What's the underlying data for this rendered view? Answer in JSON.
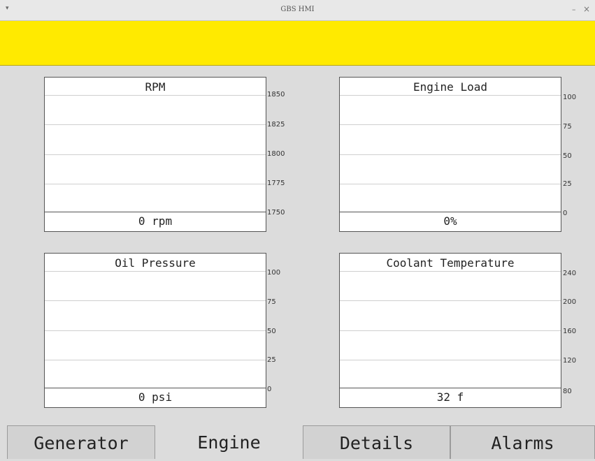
{
  "window": {
    "title": "GBS HMI",
    "menu_glyph": "▾",
    "minimize_glyph": "–",
    "close_glyph": "×"
  },
  "banner": {
    "text": "",
    "color": "#ffea00"
  },
  "gauges": {
    "rpm": {
      "title": "RPM",
      "value": "0 rpm",
      "ticks": [
        "1850",
        "1825",
        "1800",
        "1775",
        "1750"
      ]
    },
    "load": {
      "title": "Engine Load",
      "value": "0%",
      "ticks": [
        "100",
        "75",
        "50",
        "25",
        "0"
      ]
    },
    "oil": {
      "title": "Oil Pressure",
      "value": "0 psi",
      "ticks": [
        "100",
        "75",
        "50",
        "25",
        "0"
      ]
    },
    "coolant": {
      "title": "Coolant Temperature",
      "value": "32 f",
      "ticks": [
        "240",
        "200",
        "160",
        "120",
        "80"
      ]
    }
  },
  "tabs": [
    {
      "label": "Generator"
    },
    {
      "label": "Engine"
    },
    {
      "label": "Details"
    },
    {
      "label": "Alarms"
    }
  ]
}
